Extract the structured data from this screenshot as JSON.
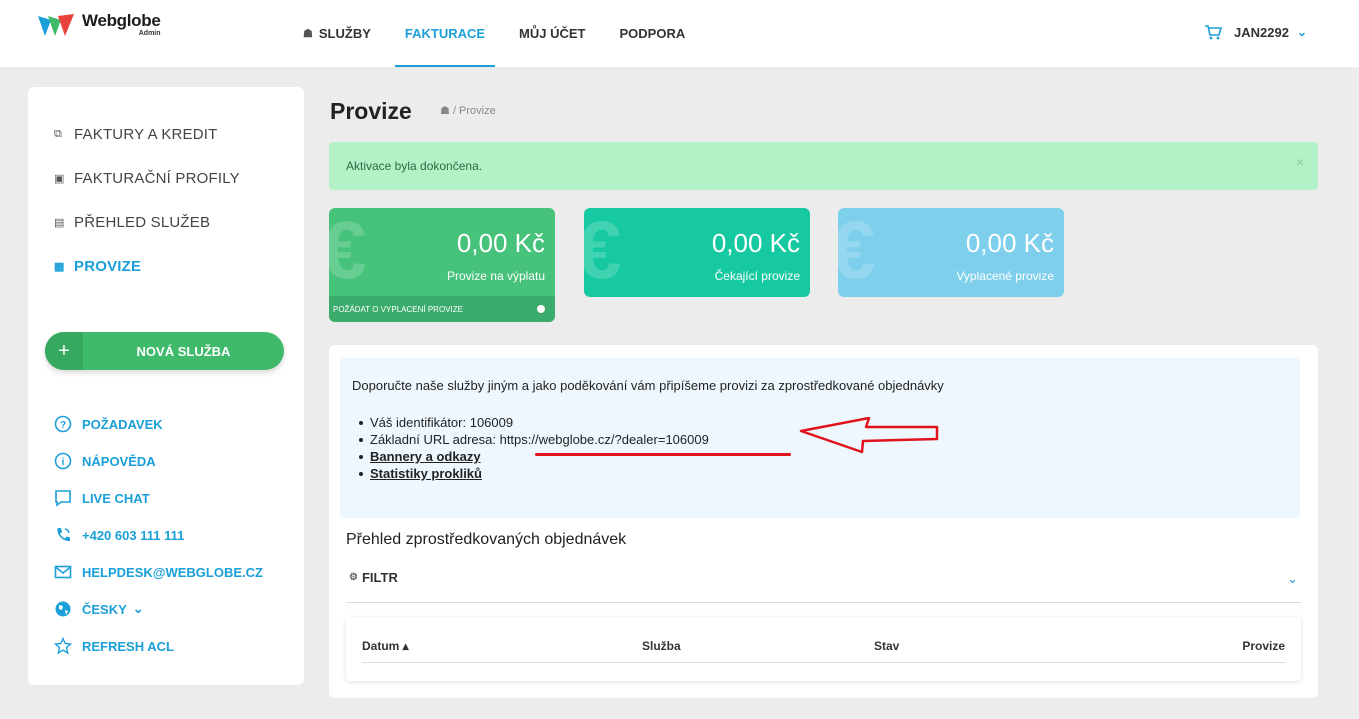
{
  "header": {
    "logo_name": "Webglobe",
    "logo_sub": "Admin",
    "nav": [
      {
        "label": "SLUŽBY",
        "icon": "home-icon"
      },
      {
        "label": "FAKTURACE",
        "active": true
      },
      {
        "label": "MŮJ ÚČET"
      },
      {
        "label": "PODPORA"
      }
    ],
    "user": "JAN2292",
    "accent": "#1a9fd8"
  },
  "sidebar": {
    "menu": [
      {
        "label": "FAKTURY A KREDIT",
        "icon": "copy-icon"
      },
      {
        "label": "FAKTURAČNÍ PROFILY",
        "icon": "id-card-icon"
      },
      {
        "label": "PŘEHLED SLUŽEB",
        "icon": "list-icon"
      },
      {
        "label": "PROVIZE",
        "icon": "money-icon",
        "active": true
      }
    ],
    "new_service": "NOVÁ SLUŽBA",
    "new_service_icon": "+",
    "links": [
      {
        "label": "POŽADAVEK",
        "icon": "question-icon"
      },
      {
        "label": "NÁPOVĚDA",
        "icon": "info-icon"
      },
      {
        "label": "LIVE CHAT",
        "icon": "chat-icon"
      },
      {
        "label": "+420 603 111 111",
        "icon": "phone-icon"
      },
      {
        "label": "HELPDESK@WEBGLOBE.CZ",
        "icon": "mail-icon"
      },
      {
        "label": "ČESKY",
        "icon": "globe-icon"
      },
      {
        "label": "REFRESH ACL",
        "icon": "star-icon"
      }
    ]
  },
  "page": {
    "title": "Provize",
    "breadcrumb": "/ Provize",
    "alert": "Aktivace byla dokončena.",
    "alert_close": "×"
  },
  "cards": [
    {
      "amount": "0,00 Kč",
      "label": "Provize na výplatu",
      "footer": "POŽÁDAT O VYPLACENÍ PROVIZE",
      "color": "#46c27b"
    },
    {
      "amount": "0,00 Kč",
      "label": "Čekající provize",
      "color": "#17c9a0"
    },
    {
      "amount": "0,00 Kč",
      "label": "Vyplacené provize",
      "color": "#7dcfec"
    }
  ],
  "referral": {
    "intro": "Doporučte naše služby jiným a jako poděkování vám připíšeme provizi za zprostředkované objednávky",
    "identifier": "Váš identifikátor: 106009",
    "url_label": "Základní URL adresa: ",
    "url": "https://webglobe.cz/?dealer=106009",
    "banners": "Bannery a odkazy",
    "stats": "Statistiky prokliků"
  },
  "orders": {
    "title": "Přehled zprostředkovaných objednávek",
    "filter": "FILTR",
    "columns": [
      "Datum ▴",
      "Služba",
      "Stav",
      "Provize"
    ]
  }
}
